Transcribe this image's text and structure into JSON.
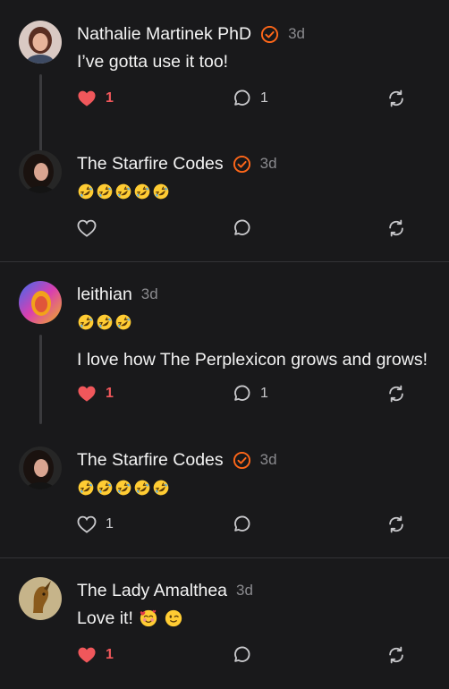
{
  "posts": [
    {
      "name": "Nathalie Martinek PhD",
      "verified": true,
      "time": "3d",
      "emoji_count": 0,
      "text": "I’ve gotta use it too!",
      "text2": "",
      "likes": "1",
      "liked": true,
      "comments": "1"
    },
    {
      "name": "The Starfire Codes",
      "verified": true,
      "time": "3d",
      "emoji_count": 5,
      "text": "",
      "text2": "",
      "likes": "",
      "liked": false,
      "comments": ""
    },
    {
      "name": "leithian",
      "verified": false,
      "time": "3d",
      "emoji_count": 3,
      "text": "",
      "text2": "I love how The Perplexicon grows and grows!",
      "likes": "1",
      "liked": true,
      "comments": "1"
    },
    {
      "name": "The Starfire Codes",
      "verified": true,
      "time": "3d",
      "emoji_count": 5,
      "text": "",
      "text2": "",
      "likes": "1",
      "liked": false,
      "comments": ""
    },
    {
      "name": "The Lady Amalthea",
      "verified": false,
      "time": "3d",
      "emoji_count": 0,
      "text": "Love it!",
      "text2": "",
      "extra_emojis": [
        "smiling-face-with-hearts",
        "winking-face"
      ],
      "likes": "1",
      "liked": true,
      "comments": ""
    }
  ],
  "colors": {
    "background": "#19191b",
    "accent": "#ff6719",
    "liked": "#f0575b",
    "muted": "#8a8a8e"
  },
  "icons": {
    "like": "heart-icon",
    "comment": "comment-icon",
    "restack": "restack-icon",
    "verified": "verified-check-icon",
    "emoji": "rolling-on-floor-laughing-emoji"
  }
}
